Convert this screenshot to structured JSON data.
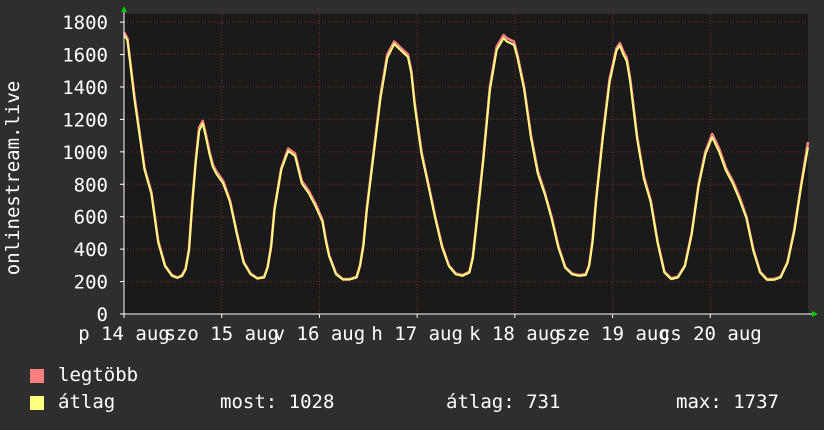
{
  "chart_data": {
    "type": "line",
    "ylabel": "onlinestream.live",
    "ylim": [
      0,
      1850
    ],
    "yticks": [
      0,
      200,
      400,
      600,
      800,
      1000,
      1200,
      1400,
      1600,
      1800
    ],
    "x_range": [
      0,
      7.8
    ],
    "xtick_labels": [
      {
        "label": "p 14 aug",
        "x": 0
      },
      {
        "label": "szo 15 aug",
        "x": 1
      },
      {
        "label": "v 16 aug",
        "x": 2
      },
      {
        "label": "h 17 aug",
        "x": 3
      },
      {
        "label": "k 18 aug",
        "x": 4
      },
      {
        "label": "sze 19 aug",
        "x": 5
      },
      {
        "label": "cs 20 aug",
        "x": 6
      }
    ],
    "grid": true,
    "series": [
      {
        "name": "legtöbb",
        "color": "#ff7f7f",
        "points": [
          [
            0.0,
            1737
          ],
          [
            0.05,
            1700
          ],
          [
            0.15,
            1350
          ],
          [
            0.3,
            900
          ],
          [
            0.4,
            750
          ],
          [
            0.5,
            450
          ],
          [
            0.6,
            300
          ],
          [
            0.7,
            240
          ],
          [
            0.78,
            225
          ],
          [
            0.85,
            240
          ],
          [
            0.9,
            280
          ],
          [
            0.95,
            400
          ],
          [
            1.0,
            700
          ],
          [
            1.05,
            950
          ],
          [
            1.1,
            1150
          ],
          [
            1.15,
            1190
          ],
          [
            1.2,
            1100
          ],
          [
            1.25,
            1000
          ],
          [
            1.3,
            920
          ],
          [
            1.35,
            880
          ],
          [
            1.45,
            820
          ],
          [
            1.55,
            700
          ],
          [
            1.65,
            500
          ],
          [
            1.75,
            320
          ],
          [
            1.85,
            250
          ],
          [
            1.95,
            220
          ],
          [
            2.05,
            230
          ],
          [
            2.1,
            290
          ],
          [
            2.15,
            420
          ],
          [
            2.2,
            650
          ],
          [
            2.3,
            900
          ],
          [
            2.4,
            1020
          ],
          [
            2.5,
            990
          ],
          [
            2.6,
            820
          ],
          [
            2.7,
            760
          ],
          [
            2.8,
            680
          ],
          [
            2.9,
            580
          ],
          [
            2.95,
            460
          ],
          [
            3.0,
            360
          ],
          [
            3.1,
            250
          ],
          [
            3.2,
            215
          ],
          [
            3.3,
            215
          ],
          [
            3.4,
            230
          ],
          [
            3.45,
            300
          ],
          [
            3.5,
            430
          ],
          [
            3.55,
            650
          ],
          [
            3.65,
            1000
          ],
          [
            3.75,
            1350
          ],
          [
            3.85,
            1600
          ],
          [
            3.95,
            1680
          ],
          [
            4.05,
            1640
          ],
          [
            4.15,
            1600
          ],
          [
            4.2,
            1500
          ],
          [
            4.25,
            1300
          ],
          [
            4.35,
            1000
          ],
          [
            4.45,
            800
          ],
          [
            4.55,
            600
          ],
          [
            4.65,
            420
          ],
          [
            4.75,
            300
          ],
          [
            4.85,
            250
          ],
          [
            4.95,
            240
          ],
          [
            5.05,
            260
          ],
          [
            5.1,
            350
          ],
          [
            5.15,
            550
          ],
          [
            5.25,
            950
          ],
          [
            5.35,
            1400
          ],
          [
            5.45,
            1650
          ],
          [
            5.55,
            1720
          ],
          [
            5.6,
            1700
          ],
          [
            5.7,
            1680
          ],
          [
            5.75,
            1600
          ],
          [
            5.85,
            1400
          ],
          [
            5.95,
            1100
          ],
          [
            6.05,
            880
          ],
          [
            6.15,
            750
          ],
          [
            6.25,
            600
          ],
          [
            6.35,
            420
          ],
          [
            6.45,
            290
          ],
          [
            6.55,
            250
          ],
          [
            6.65,
            240
          ],
          [
            6.75,
            245
          ],
          [
            6.8,
            300
          ],
          [
            6.85,
            450
          ],
          [
            6.9,
            700
          ],
          [
            7.0,
            1100
          ],
          [
            7.1,
            1450
          ],
          [
            7.2,
            1640
          ],
          [
            7.25,
            1670
          ],
          [
            7.3,
            1620
          ],
          [
            7.35,
            1580
          ],
          [
            7.4,
            1450
          ],
          [
            7.5,
            1100
          ],
          [
            7.6,
            850
          ],
          [
            7.7,
            700
          ],
          [
            7.8,
            450
          ],
          [
            7.9,
            260
          ],
          [
            8.0,
            220
          ],
          [
            8.1,
            230
          ],
          [
            8.2,
            300
          ],
          [
            8.3,
            500
          ],
          [
            8.4,
            800
          ],
          [
            8.5,
            1000
          ],
          [
            8.6,
            1110
          ],
          [
            8.7,
            1020
          ],
          [
            8.8,
            900
          ],
          [
            8.9,
            820
          ],
          [
            9.0,
            720
          ],
          [
            9.1,
            600
          ],
          [
            9.2,
            400
          ],
          [
            9.3,
            260
          ],
          [
            9.4,
            215
          ],
          [
            9.5,
            215
          ],
          [
            9.6,
            230
          ],
          [
            9.7,
            320
          ],
          [
            9.8,
            520
          ],
          [
            9.9,
            800
          ],
          [
            10.0,
            1060
          ]
        ]
      },
      {
        "name": "átlag",
        "color": "#ffff7f",
        "points": [
          [
            0.0,
            1720
          ],
          [
            0.05,
            1690
          ],
          [
            0.15,
            1330
          ],
          [
            0.3,
            890
          ],
          [
            0.4,
            740
          ],
          [
            0.5,
            440
          ],
          [
            0.6,
            295
          ],
          [
            0.7,
            235
          ],
          [
            0.78,
            222
          ],
          [
            0.85,
            235
          ],
          [
            0.9,
            275
          ],
          [
            0.95,
            390
          ],
          [
            1.0,
            690
          ],
          [
            1.05,
            940
          ],
          [
            1.1,
            1130
          ],
          [
            1.15,
            1175
          ],
          [
            1.2,
            1085
          ],
          [
            1.25,
            985
          ],
          [
            1.3,
            905
          ],
          [
            1.35,
            865
          ],
          [
            1.45,
            805
          ],
          [
            1.55,
            690
          ],
          [
            1.65,
            490
          ],
          [
            1.75,
            315
          ],
          [
            1.85,
            245
          ],
          [
            1.95,
            218
          ],
          [
            2.05,
            225
          ],
          [
            2.1,
            285
          ],
          [
            2.15,
            410
          ],
          [
            2.2,
            640
          ],
          [
            2.3,
            890
          ],
          [
            2.4,
            1005
          ],
          [
            2.5,
            975
          ],
          [
            2.6,
            805
          ],
          [
            2.7,
            745
          ],
          [
            2.8,
            665
          ],
          [
            2.9,
            570
          ],
          [
            2.95,
            450
          ],
          [
            3.0,
            355
          ],
          [
            3.1,
            245
          ],
          [
            3.2,
            212
          ],
          [
            3.3,
            212
          ],
          [
            3.4,
            225
          ],
          [
            3.45,
            295
          ],
          [
            3.5,
            420
          ],
          [
            3.55,
            640
          ],
          [
            3.65,
            985
          ],
          [
            3.75,
            1330
          ],
          [
            3.85,
            1580
          ],
          [
            3.95,
            1665
          ],
          [
            4.05,
            1625
          ],
          [
            4.15,
            1585
          ],
          [
            4.2,
            1485
          ],
          [
            4.25,
            1285
          ],
          [
            4.35,
            985
          ],
          [
            4.45,
            790
          ],
          [
            4.55,
            590
          ],
          [
            4.65,
            410
          ],
          [
            4.75,
            295
          ],
          [
            4.85,
            245
          ],
          [
            4.95,
            235
          ],
          [
            5.05,
            255
          ],
          [
            5.1,
            345
          ],
          [
            5.15,
            540
          ],
          [
            5.25,
            935
          ],
          [
            5.35,
            1380
          ],
          [
            5.45,
            1630
          ],
          [
            5.55,
            1700
          ],
          [
            5.6,
            1680
          ],
          [
            5.7,
            1660
          ],
          [
            5.75,
            1585
          ],
          [
            5.85,
            1385
          ],
          [
            5.95,
            1085
          ],
          [
            6.05,
            865
          ],
          [
            6.15,
            740
          ],
          [
            6.25,
            590
          ],
          [
            6.35,
            410
          ],
          [
            6.45,
            285
          ],
          [
            6.55,
            245
          ],
          [
            6.65,
            235
          ],
          [
            6.75,
            240
          ],
          [
            6.8,
            295
          ],
          [
            6.85,
            440
          ],
          [
            6.9,
            690
          ],
          [
            7.0,
            1085
          ],
          [
            7.1,
            1430
          ],
          [
            7.2,
            1625
          ],
          [
            7.25,
            1655
          ],
          [
            7.3,
            1600
          ],
          [
            7.35,
            1560
          ],
          [
            7.4,
            1430
          ],
          [
            7.5,
            1085
          ],
          [
            7.6,
            835
          ],
          [
            7.7,
            690
          ],
          [
            7.8,
            440
          ],
          [
            7.9,
            255
          ],
          [
            8.0,
            215
          ],
          [
            8.1,
            225
          ],
          [
            8.2,
            295
          ],
          [
            8.3,
            490
          ],
          [
            8.4,
            790
          ],
          [
            8.5,
            985
          ],
          [
            8.6,
            1090
          ],
          [
            8.7,
            1000
          ],
          [
            8.8,
            885
          ],
          [
            8.9,
            805
          ],
          [
            9.0,
            705
          ],
          [
            9.1,
            590
          ],
          [
            9.2,
            390
          ],
          [
            9.3,
            255
          ],
          [
            9.4,
            210
          ],
          [
            9.5,
            210
          ],
          [
            9.6,
            225
          ],
          [
            9.7,
            315
          ],
          [
            9.8,
            510
          ],
          [
            9.9,
            790
          ],
          [
            10.0,
            1028
          ]
        ]
      }
    ],
    "stats": {
      "now": "most: 1028",
      "avg": "átlag: 731",
      "max": "max: 1737"
    },
    "colors": {
      "background": "#2e2e2e",
      "plot_area": "#1a1a1a",
      "grid": "#7a2b2b",
      "axis": "#ffffff",
      "arrow": "#00cc00"
    }
  }
}
